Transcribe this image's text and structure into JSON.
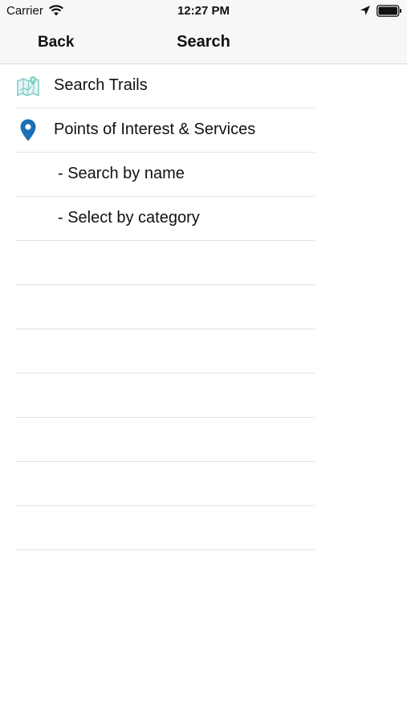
{
  "status_bar": {
    "carrier": "Carrier",
    "time": "12:27 PM",
    "icons": [
      "wifi-icon",
      "location-arrow-icon",
      "battery-icon"
    ]
  },
  "nav_bar": {
    "back_label": "Back",
    "title": "Search"
  },
  "menu": {
    "items": [
      {
        "label": "Search Trails",
        "icon": "trail-map-icon"
      },
      {
        "label": "Points of Interest & Services",
        "icon": "map-pin-icon"
      },
      {
        "label": "- Search by name",
        "icon": ""
      },
      {
        "label": "- Select by category",
        "icon": ""
      }
    ]
  },
  "colors": {
    "map_icon": "#7fcfc6",
    "pin_icon": "#1a6fb5",
    "separator": "#e3e3e3",
    "bar_background": "#f7f7f7"
  }
}
